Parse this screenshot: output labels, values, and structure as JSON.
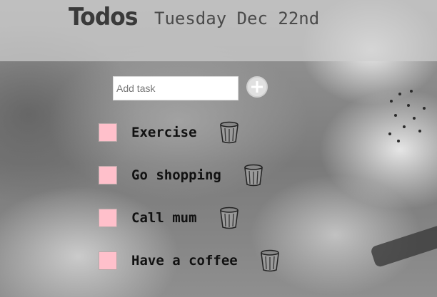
{
  "header": {
    "title": "Todos",
    "date": "Tuesday Dec 22nd"
  },
  "add_task": {
    "placeholder": "Add task",
    "button_icon": "plus-icon"
  },
  "todos": [
    {
      "label": "Exercise",
      "done": false
    },
    {
      "label": "Go shopping",
      "done": false
    },
    {
      "label": "Call mum",
      "done": false
    },
    {
      "label": "Have a coffee",
      "done": false
    }
  ],
  "icons": {
    "checkbox": "checkbox-icon",
    "delete": "trash-icon"
  },
  "colors": {
    "checkbox_fill": "#ffc0cb",
    "header_overlay": "#cdcdcd",
    "text": "#111111"
  }
}
